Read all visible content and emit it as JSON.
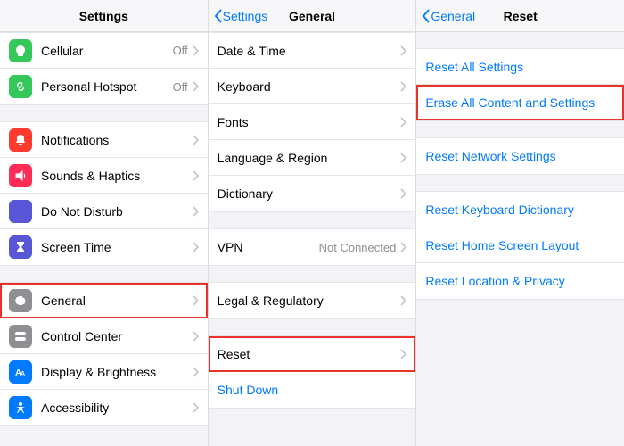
{
  "panel1": {
    "title": "Settings",
    "g1": [
      {
        "label": "Cellular",
        "value": "Off",
        "icon": "antenna-icon",
        "cls": "i-green"
      },
      {
        "label": "Personal Hotspot",
        "value": "Off",
        "icon": "link-icon",
        "cls": "i-green2"
      }
    ],
    "g2": [
      {
        "label": "Notifications",
        "icon": "bell-icon",
        "cls": "i-red"
      },
      {
        "label": "Sounds & Haptics",
        "icon": "speaker-icon",
        "cls": "i-pink"
      },
      {
        "label": "Do Not Disturb",
        "icon": "moon-icon",
        "cls": "i-purple"
      },
      {
        "label": "Screen Time",
        "icon": "hourglass-icon",
        "cls": "i-indigo"
      }
    ],
    "g3": [
      {
        "label": "General",
        "icon": "gear-icon",
        "cls": "i-gray",
        "highlight": true
      },
      {
        "label": "Control Center",
        "icon": "switches-icon",
        "cls": "i-gray"
      },
      {
        "label": "Display & Brightness",
        "icon": "text-size-icon",
        "cls": "i-blue"
      },
      {
        "label": "Accessibility",
        "icon": "accessibility-icon",
        "cls": "i-blue"
      }
    ]
  },
  "panel2": {
    "back": "Settings",
    "title": "General",
    "g1": [
      {
        "label": "Date & Time"
      },
      {
        "label": "Keyboard"
      },
      {
        "label": "Fonts"
      },
      {
        "label": "Language & Region"
      },
      {
        "label": "Dictionary"
      }
    ],
    "g2": [
      {
        "label": "VPN",
        "value": "Not Connected"
      }
    ],
    "g3": [
      {
        "label": "Legal & Regulatory"
      }
    ],
    "g4": [
      {
        "label": "Reset",
        "highlight": true
      },
      {
        "label": "Shut Down",
        "link": true
      }
    ]
  },
  "panel3": {
    "back": "General",
    "title": "Reset",
    "g1": [
      {
        "label": "Reset All Settings",
        "link": true
      },
      {
        "label": "Erase All Content and Settings",
        "link": true,
        "highlight": true
      }
    ],
    "g2": [
      {
        "label": "Reset Network Settings",
        "link": true
      }
    ],
    "g3": [
      {
        "label": "Reset Keyboard Dictionary",
        "link": true
      },
      {
        "label": "Reset Home Screen Layout",
        "link": true
      },
      {
        "label": "Reset Location & Privacy",
        "link": true
      }
    ]
  }
}
